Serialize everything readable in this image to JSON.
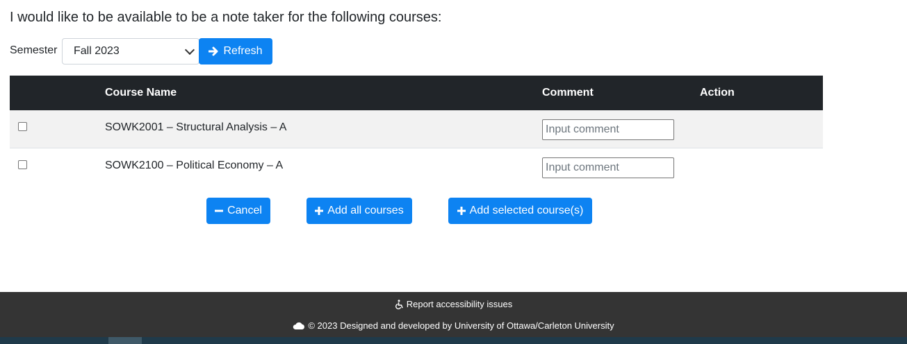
{
  "intro": "I would like to be available to be a note taker for the following courses:",
  "semester": {
    "label": "Semester",
    "selected": "Fall 2023"
  },
  "refresh_label": "Refresh",
  "table": {
    "columns": [
      "",
      "Course Name",
      "Comment",
      "Action"
    ],
    "rows": [
      {
        "course": "SOWK2001 – Structural Analysis – A",
        "comment_placeholder": "Input comment"
      },
      {
        "course": "SOWK2100 – Political Economy – A",
        "comment_placeholder": "Input comment"
      }
    ]
  },
  "actions": {
    "cancel": "Cancel",
    "add_all": "Add all courses",
    "add_selected": "Add selected course(s)"
  },
  "footer": {
    "accessibility": "Report accessibility issues",
    "copyright": "© 2023 Designed and developed by University of Ottawa/Carleton University"
  },
  "colors": {
    "primary": "#0d83f2",
    "table_header": "#212529",
    "footer": "#343434"
  },
  "icons": [
    "arrow-right-icon",
    "minus-icon",
    "plus-icon",
    "wheelchair-icon",
    "cloud-icon"
  ]
}
